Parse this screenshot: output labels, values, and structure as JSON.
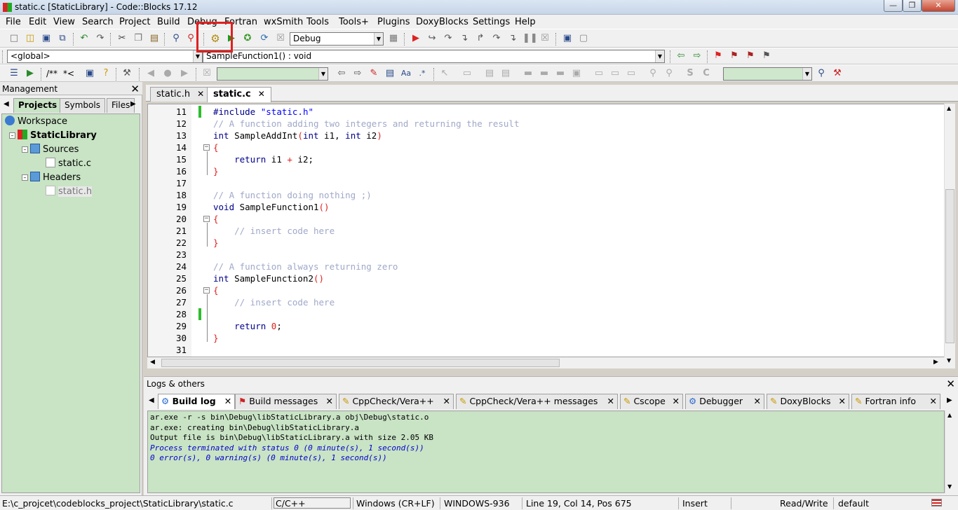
{
  "window": {
    "title": "static.c [StaticLibrary] - Code::Blocks 17.12"
  },
  "menu": [
    "File",
    "Edit",
    "View",
    "Search",
    "Project",
    "Build",
    "Debug",
    "Fortran",
    "wxSmith",
    "Tools",
    "Tools+",
    "Plugins",
    "DoxyBlocks",
    "Settings",
    "Help"
  ],
  "toolbar": {
    "build_target": "Debug",
    "scope": "<global>",
    "function": "SampleFunction1() : void",
    "doxy_comment_label": "/**",
    "doxy_inline_label": "*<"
  },
  "management": {
    "title": "Management",
    "tabs": [
      "Projects",
      "Symbols",
      "Files"
    ],
    "tree": {
      "workspace": "Workspace",
      "project": "StaticLibrary",
      "sources_folder": "Sources",
      "source_file": "static.c",
      "headers_folder": "Headers",
      "header_file": "static.h"
    }
  },
  "editor": {
    "tabs": [
      {
        "label": "static.h"
      },
      {
        "label": "static.c"
      }
    ],
    "lines": [
      {
        "n": "11",
        "html": "<span class=\"kw\">#include</span> <span class=\"str\">\"static.h\"</span>"
      },
      {
        "n": "12",
        "html": "<span class=\"cm\">// A function adding two integers and returning the result</span>"
      },
      {
        "n": "13",
        "html": "<span class=\"kw\">int</span> SampleAddInt<span class=\"br\">(</span><span class=\"kw\">int</span> i1, <span class=\"kw\">int</span> i2<span class=\"br\">)</span>"
      },
      {
        "n": "14",
        "html": "<span class=\"br\">{</span>"
      },
      {
        "n": "15",
        "html": "    <span class=\"kw\">return</span> i1 <span class=\"br\">+</span> i2;"
      },
      {
        "n": "16",
        "html": "<span class=\"br\">}</span>"
      },
      {
        "n": "17",
        "html": ""
      },
      {
        "n": "18",
        "html": "<span class=\"cm\">// A function doing nothing ;)</span>"
      },
      {
        "n": "19",
        "html": "<span class=\"kw\">void</span> SampleFunction1<span class=\"br\">()</span>"
      },
      {
        "n": "20",
        "html": "<span class=\"br\">{</span>"
      },
      {
        "n": "21",
        "html": "    <span class=\"cm\">// insert code here</span>"
      },
      {
        "n": "22",
        "html": "<span class=\"br\">}</span>"
      },
      {
        "n": "23",
        "html": ""
      },
      {
        "n": "24",
        "html": "<span class=\"cm\">// A function always returning zero</span>"
      },
      {
        "n": "25",
        "html": "<span class=\"kw\">int</span> SampleFunction2<span class=\"br\">()</span>"
      },
      {
        "n": "26",
        "html": "<span class=\"br\">{</span>"
      },
      {
        "n": "27",
        "html": "    <span class=\"cm\">// insert code here</span>"
      },
      {
        "n": "28",
        "html": ""
      },
      {
        "n": "29",
        "html": "    <span class=\"kw\">return</span> <span class=\"num\">0</span>;"
      },
      {
        "n": "30",
        "html": "<span class=\"br\">}</span>"
      },
      {
        "n": "31",
        "html": ""
      }
    ]
  },
  "logs": {
    "title": "Logs & others",
    "tabs": [
      "Build log",
      "Build messages",
      "CppCheck/Vera++",
      "CppCheck/Vera++ messages",
      "Cscope",
      "Debugger",
      "DoxyBlocks",
      "Fortran info"
    ],
    "lines": [
      {
        "text": "ar.exe -r -s bin\\Debug\\libStaticLibrary.a obj\\Debug\\static.o",
        "type": "plain"
      },
      {
        "text": "ar.exe: creating bin\\Debug\\libStaticLibrary.a",
        "type": "plain"
      },
      {
        "text": "Output file is bin\\Debug\\libStaticLibrary.a with size 2.05 KB",
        "type": "plain"
      },
      {
        "text": "Process terminated with status 0 (0 minute(s), 1 second(s))",
        "type": "info"
      },
      {
        "text": "0 error(s), 0 warning(s) (0 minute(s), 1 second(s))",
        "type": "info"
      }
    ]
  },
  "status": {
    "path": "E:\\c_projcet\\codeblocks_project\\StaticLibrary\\static.c",
    "language": "C/C++",
    "eol": "Windows (CR+LF)",
    "encoding": "WINDOWS-936",
    "position": "Line 19, Col 14, Pos 675",
    "mode": "Insert",
    "access": "Read/Write",
    "profile": "default"
  }
}
